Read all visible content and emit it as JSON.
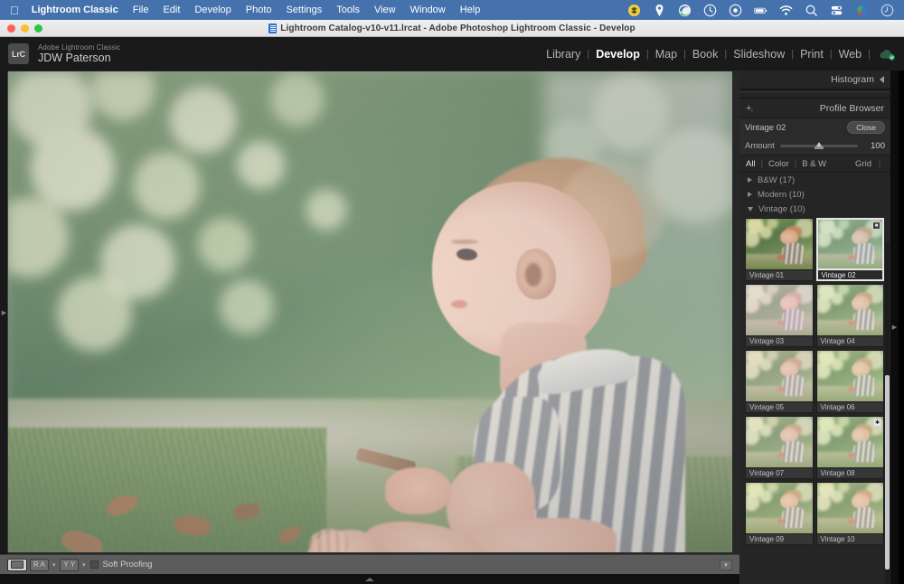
{
  "menubar": {
    "apple_icon": "apple-icon",
    "app_name": "Lightroom Classic",
    "items": [
      "File",
      "Edit",
      "Develop",
      "Photo",
      "Settings",
      "Tools",
      "View",
      "Window",
      "Help"
    ],
    "status_icons": [
      "dropbox-icon",
      "location-icon",
      "edge-browser-icon",
      "time-machine-icon",
      "record-icon",
      "battery-icon",
      "wifi-icon",
      "search-icon",
      "control-center-icon",
      "display-color-icon",
      "clock-icon"
    ],
    "background_color": "#4572ad"
  },
  "window": {
    "title": "Lightroom Catalog-v10-v11.lrcat - Adobe Photoshop Lightroom Classic - Develop",
    "traffic_lights": [
      "close-red",
      "minimize-yellow",
      "maximize-green"
    ]
  },
  "appheader": {
    "logo_text": "LrC",
    "product_name": "Adobe Lightroom Classic",
    "user_name": "JDW Paterson",
    "modules": [
      {
        "label": "Library",
        "active": false
      },
      {
        "label": "Develop",
        "active": true
      },
      {
        "label": "Map",
        "active": false
      },
      {
        "label": "Book",
        "active": false
      },
      {
        "label": "Slideshow",
        "active": false
      },
      {
        "label": "Print",
        "active": false
      },
      {
        "label": "Web",
        "active": false
      }
    ],
    "separator": "|",
    "cloud_icon": "cloud-sync-icon"
  },
  "rightpanel": {
    "histogram_label": "Histogram",
    "histogram_collapse_icon": "triangle-left-icon",
    "profile_browser": {
      "add_icon": "+.",
      "title": "Profile Browser",
      "current_profile": "Vintage 02",
      "close_label": "Close",
      "amount_label": "Amount",
      "amount_value": "100",
      "amount_percent": 50
    },
    "filters": [
      {
        "label": "All",
        "active": true
      },
      {
        "label": "Color",
        "active": false
      },
      {
        "label": "B & W",
        "active": false
      }
    ],
    "view_label": "Grid",
    "view_more_icon": "more-options-icon",
    "groups": [
      {
        "label": "B&W (17)",
        "expanded": false
      },
      {
        "label": "Modern (10)",
        "expanded": false
      },
      {
        "label": "Vintage (10)",
        "expanded": true
      }
    ],
    "presets": [
      {
        "label": "Vintage 01",
        "selected": false,
        "badge": null
      },
      {
        "label": "Vintage 02",
        "selected": true,
        "badge": "selected-badge-icon"
      },
      {
        "label": "Vintage 03",
        "selected": false,
        "badge": null
      },
      {
        "label": "Vintage 04",
        "selected": false,
        "badge": null
      },
      {
        "label": "Vintage 05",
        "selected": false,
        "badge": null
      },
      {
        "label": "Vintage 06",
        "selected": false,
        "badge": null
      },
      {
        "label": "Vintage 07",
        "selected": false,
        "badge": null
      },
      {
        "label": "Vintage 08",
        "selected": false,
        "badge": "favorite-star-icon"
      },
      {
        "label": "Vintage 09",
        "selected": false,
        "badge": null
      },
      {
        "label": "Vintage 10",
        "selected": false,
        "badge": null
      }
    ]
  },
  "toolbar": {
    "view_loupe_icon": "loupe-view-icon",
    "before_after_label": "R A",
    "before_after_caret": "▾",
    "yy_label": "Y Y",
    "yy_caret": "▾",
    "soft_proofing_label": "Soft Proofing",
    "soft_proofing_checked": false,
    "overflow_caret": "▾"
  },
  "edges": {
    "left_toggle_icon": "panel-expand-left-icon",
    "right_toggle_icon": "panel-expand-right-icon",
    "filmstrip_toggle_icon": "filmstrip-expand-icon"
  },
  "photo": {
    "description": "Baby in profile sitting on grass holding a stick, blurred green foliage background, vintage faded color grade"
  }
}
